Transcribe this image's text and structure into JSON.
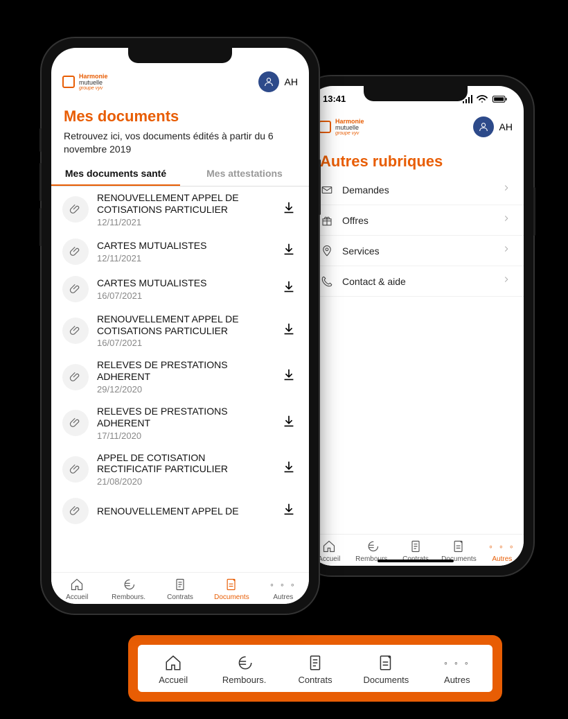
{
  "brand": {
    "line1": "Harmonie",
    "line2": "mutuelle",
    "line3": "groupe vyv"
  },
  "user": {
    "initials": "AH"
  },
  "status": {
    "time": "13:41"
  },
  "left": {
    "title": "Mes documents",
    "subtitle": "Retrouvez ici, vos documents édités à partir du 6 novembre 2019",
    "tabs": {
      "active": "Mes documents santé",
      "inactive": "Mes attestations"
    },
    "documents": [
      {
        "title": "RENOUVELLEMENT APPEL DE COTISATIONS PARTICULIER",
        "date": "12/11/2021"
      },
      {
        "title": "CARTES MUTUALISTES",
        "date": "12/11/2021"
      },
      {
        "title": "CARTES MUTUALISTES",
        "date": "16/07/2021"
      },
      {
        "title": "RENOUVELLEMENT APPEL DE COTISATIONS PARTICULIER",
        "date": "16/07/2021"
      },
      {
        "title": "RELEVES DE PRESTATIONS ADHERENT",
        "date": "29/12/2020"
      },
      {
        "title": "RELEVES DE PRESTATIONS ADHERENT",
        "date": "17/11/2020"
      },
      {
        "title": "APPEL DE COTISATION RECTIFICATIF PARTICULIER",
        "date": "21/08/2020"
      },
      {
        "title": "RENOUVELLEMENT APPEL DE",
        "date": ""
      }
    ],
    "nav": [
      {
        "label": "Accueil",
        "icon": "home"
      },
      {
        "label": "Rembours.",
        "icon": "euro"
      },
      {
        "label": "Contrats",
        "icon": "contract"
      },
      {
        "label": "Documents",
        "icon": "document",
        "active": true
      },
      {
        "label": "Autres",
        "icon": "dots"
      }
    ]
  },
  "right": {
    "title": "Autres rubriques",
    "items": [
      {
        "label": "Demandes",
        "icon": "envelope"
      },
      {
        "label": "Offres",
        "icon": "gift"
      },
      {
        "label": "Services",
        "icon": "pin"
      },
      {
        "label": "Contact & aide",
        "icon": "phone"
      }
    ],
    "nav": [
      {
        "label": "Accueil",
        "icon": "home"
      },
      {
        "label": "Rembours.",
        "icon": "euro"
      },
      {
        "label": "Contrats",
        "icon": "contract"
      },
      {
        "label": "Documents",
        "icon": "document"
      },
      {
        "label": "Autres",
        "icon": "dots",
        "active": true
      }
    ]
  },
  "bigNav": [
    {
      "label": "Accueil",
      "icon": "home"
    },
    {
      "label": "Rembours.",
      "icon": "euro"
    },
    {
      "label": "Contrats",
      "icon": "contract"
    },
    {
      "label": "Documents",
      "icon": "document"
    },
    {
      "label": "Autres",
      "icon": "dots"
    }
  ]
}
